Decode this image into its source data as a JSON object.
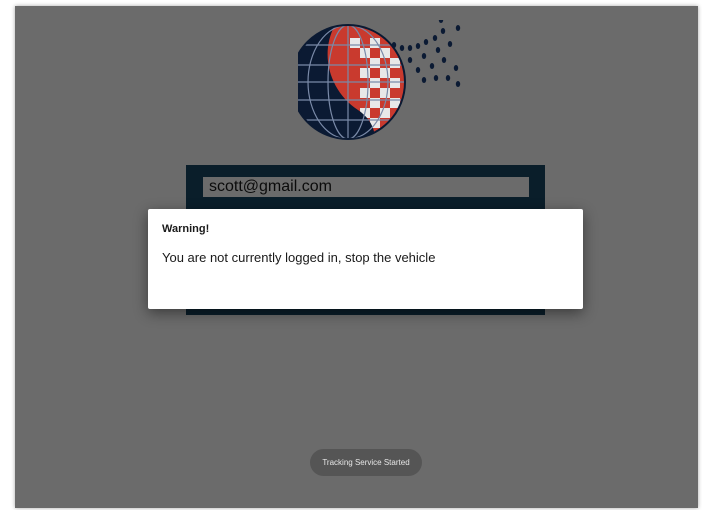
{
  "login": {
    "email_value": "scott@gmail.com"
  },
  "dialog": {
    "title": "Warning!",
    "message": "You are not currently logged in, stop the vehicle"
  },
  "toast": {
    "text": "Tracking Service Started"
  },
  "logo": {
    "icon": "globe-logo-icon"
  },
  "colors": {
    "overlay_background": "#6b6b6b",
    "login_panel": "#0a1e2a",
    "globe_red": "#a32a1f",
    "globe_navy": "#0b1a33",
    "dialog_background": "#ffffff",
    "toast_background": "#555555"
  }
}
